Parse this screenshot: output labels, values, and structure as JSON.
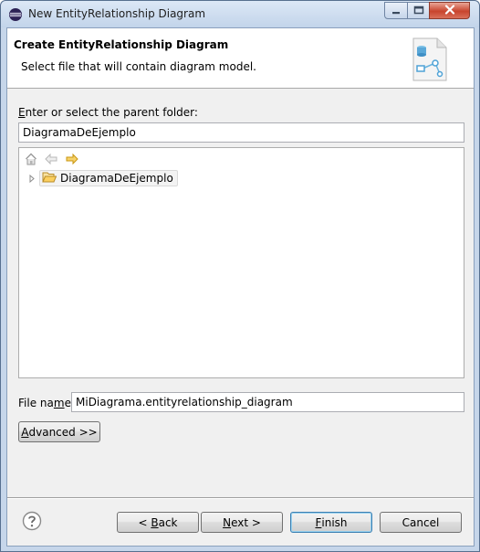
{
  "window": {
    "title": "New EntityRelationship Diagram"
  },
  "header": {
    "title": "Create EntityRelationship Diagram",
    "description": "Select file that will contain diagram model."
  },
  "parent_folder": {
    "label_prefix": "",
    "label_mnemonic": "E",
    "label_rest": "nter or select the parent folder:",
    "value": "DiagramaDeEjemplo"
  },
  "tree": {
    "toolbar_icons": [
      "home-icon",
      "back-arrow-icon",
      "forward-arrow-icon"
    ],
    "items": [
      {
        "label": "DiagramaDeEjemplo",
        "icon": "open-folder-icon",
        "expanded": false
      }
    ]
  },
  "file_name": {
    "label_prefix": "File na",
    "label_mnemonic": "m",
    "label_rest": "e:",
    "value": "MiDiagrama.entityrelationship_diagram"
  },
  "advanced_button": {
    "mnemonic": "A",
    "rest": "dvanced >>"
  },
  "buttons": {
    "back": {
      "prefix": "< ",
      "mnemonic": "B",
      "rest": "ack"
    },
    "next": {
      "prefix": "",
      "mnemonic": "N",
      "rest": "ext >"
    },
    "finish": {
      "prefix": "",
      "mnemonic": "F",
      "rest": "inish"
    },
    "cancel": {
      "label": "Cancel"
    }
  },
  "colors": {
    "window_frame": "#c6d6ea",
    "close_button": "#c8442d",
    "default_button_border": "#3c7fb1"
  }
}
